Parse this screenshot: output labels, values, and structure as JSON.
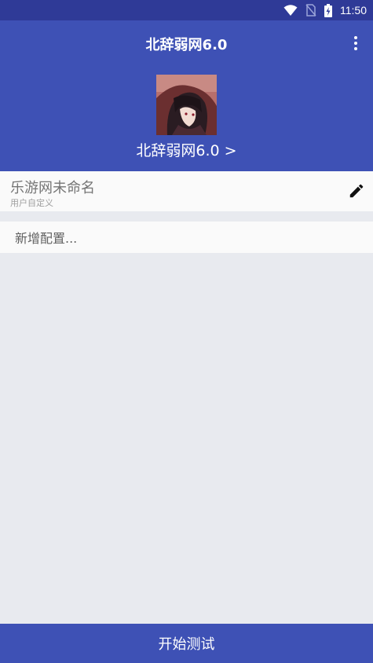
{
  "status_bar": {
    "time": "11:50",
    "icons": [
      "wifi-icon",
      "no-sim-icon",
      "battery-charging-icon"
    ]
  },
  "app_bar": {
    "title": "北辞弱网6.0",
    "menu_icon": "more-vert-icon",
    "profile_name": "北辞弱网6.0 >"
  },
  "config": {
    "name": "乐游网未命名",
    "subtitle": "用户自定义",
    "edit_icon": "edit-pencil-icon"
  },
  "add_config": {
    "label": "新增配置..."
  },
  "bottom_button": {
    "label": "开始测试"
  },
  "colors": {
    "status_bar": "#2f3a97",
    "primary": "#3e51b5",
    "background": "#e8eaef",
    "card": "#fafafa"
  }
}
